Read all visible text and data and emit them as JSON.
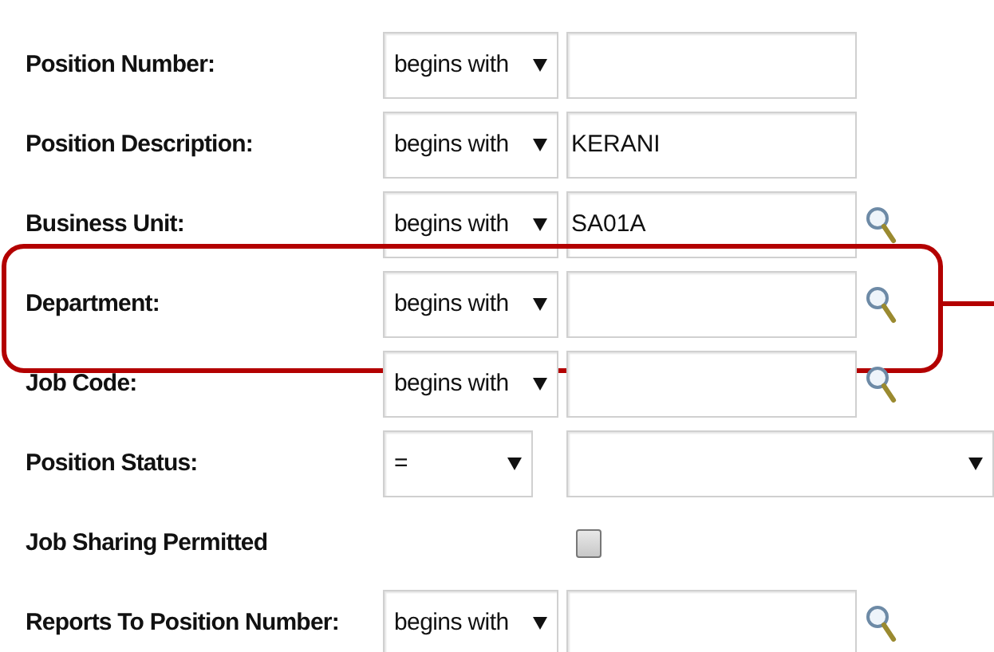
{
  "fields": [
    {
      "kind": "search",
      "label": "Position Number:",
      "operator": "begins with",
      "lookup": false,
      "highlighted": false
    },
    {
      "kind": "search",
      "label": "Position Description:",
      "operator": "begins with",
      "value": "KERANI",
      "lookup": false,
      "highlighted": false
    },
    {
      "kind": "search",
      "label": "Business Unit:",
      "operator": "begins with",
      "value": "SA01A",
      "lookup": true,
      "highlighted": false
    },
    {
      "kind": "search",
      "label": "Department:",
      "operator": "begins with",
      "lookup": true,
      "highlighted": true
    },
    {
      "kind": "search",
      "label": "Job Code:",
      "operator": "begins with",
      "lookup": true,
      "highlighted": false
    },
    {
      "kind": "select",
      "label": "Position Status:",
      "operator": "="
    },
    {
      "kind": "checkbox",
      "label": "Job Sharing Permitted",
      "checked": false
    },
    {
      "kind": "search",
      "label": "Reports To Position Number:",
      "operator": "begins with",
      "lookup": true,
      "highlighted": false
    }
  ]
}
